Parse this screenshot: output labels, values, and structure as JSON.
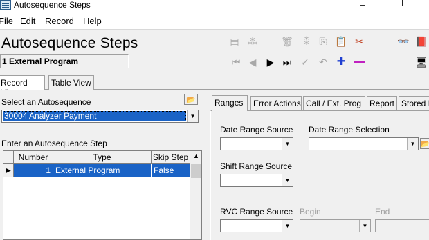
{
  "window": {
    "title": "Autosequence Steps"
  },
  "menu": [
    "File",
    "Edit",
    "Record",
    "Help"
  ],
  "header": {
    "title": "Autosequence Steps",
    "record_label": "1  External Program"
  },
  "view_tabs": [
    "Record View",
    "Table View"
  ],
  "left": {
    "select_label": "Select an Autosequence",
    "select_value": "30004  Analyzer Payment",
    "step_label": "Enter an Autosequence Step",
    "grid": {
      "columns": [
        "Number",
        "Type",
        "Skip Step"
      ],
      "rows": [
        {
          "number": "1",
          "type": "External Program",
          "skip": "False"
        }
      ]
    }
  },
  "right": {
    "tabs": [
      "Ranges",
      "Error Actions",
      "Call / Ext. Prog",
      "Report",
      "Stored Pr"
    ],
    "date_range_source_label": "Date Range Source",
    "date_range_selection_label": "Date Range Selection",
    "shift_range_source_label": "Shift Range Source",
    "rvc_range_source_label": "RVC Range Source",
    "begin_label": "Begin",
    "end_label": "End"
  },
  "colors": {
    "selection": "#1a63c6",
    "plus": "#1f3fd1",
    "minus": "#c020c0"
  }
}
